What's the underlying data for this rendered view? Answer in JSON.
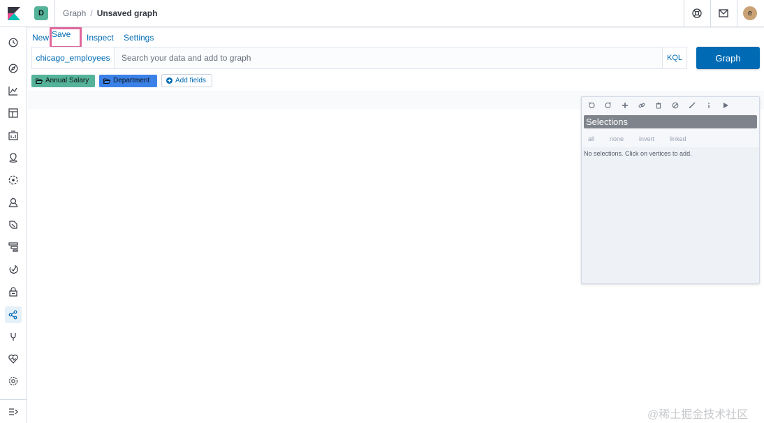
{
  "header": {
    "space_initial": "D",
    "breadcrumbs": [
      "Graph",
      "Unsaved graph"
    ],
    "crumb_separator": "/",
    "avatar_initial": "e",
    "icons": [
      "help-icon",
      "newsfeed-icon"
    ]
  },
  "leftnav": {
    "items": [
      "recent",
      "discover",
      "visualize",
      "dashboard",
      "canvas",
      "maps",
      "machine-learning",
      "infrastructure",
      "logs",
      "apm",
      "uptime",
      "siem",
      "graph",
      "dev-tools",
      "monitoring",
      "management"
    ],
    "active": "graph",
    "collapse_icon": "collapse-menu-icon"
  },
  "menu": {
    "new": "New",
    "save": "Save",
    "inspect": "Inspect",
    "settings": "Settings"
  },
  "search": {
    "index": "chicago_employees",
    "placeholder": "Search your data and add to graph",
    "value": "",
    "language": "KQL",
    "submit": "Graph"
  },
  "fields": {
    "items": [
      {
        "label": "Annual Salary",
        "color": "#54b399"
      },
      {
        "label": "Department",
        "color": "#3b82e8"
      }
    ],
    "add_label": "Add fields"
  },
  "panel": {
    "toolbar_icons": [
      "undo-icon",
      "redo-icon",
      "expand-icon",
      "link-icon",
      "delete-icon",
      "blacklist-icon",
      "style-icon",
      "info-icon",
      "play-icon"
    ],
    "title": "Selections",
    "links": [
      "all",
      "none",
      "invert",
      "linked"
    ],
    "empty_text": "No selections. Click on vertices to add."
  },
  "colors": {
    "accent": "#006bb4",
    "highlight": "#e0669b"
  },
  "watermark": "@稀土掘金技术社区"
}
